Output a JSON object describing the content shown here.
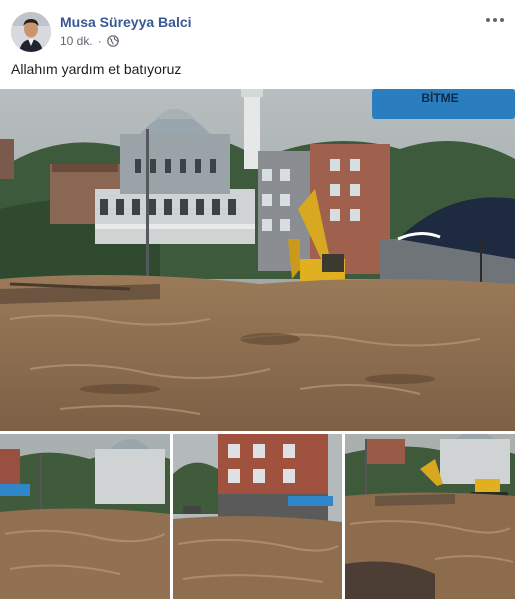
{
  "post": {
    "author": "Musa Süreyya Balci",
    "time": "10 dk.",
    "separator": "·",
    "privacy_icon": "globe-icon",
    "more_icon": "more-options-icon",
    "text": "Allahım yardım et batıyoruz"
  },
  "photos": {
    "main": {
      "sign_text": "BİTME"
    }
  },
  "colors": {
    "author": "#385898",
    "meta": "#606770",
    "mud": "#8a6a4a",
    "excavator": "#e0b020"
  }
}
